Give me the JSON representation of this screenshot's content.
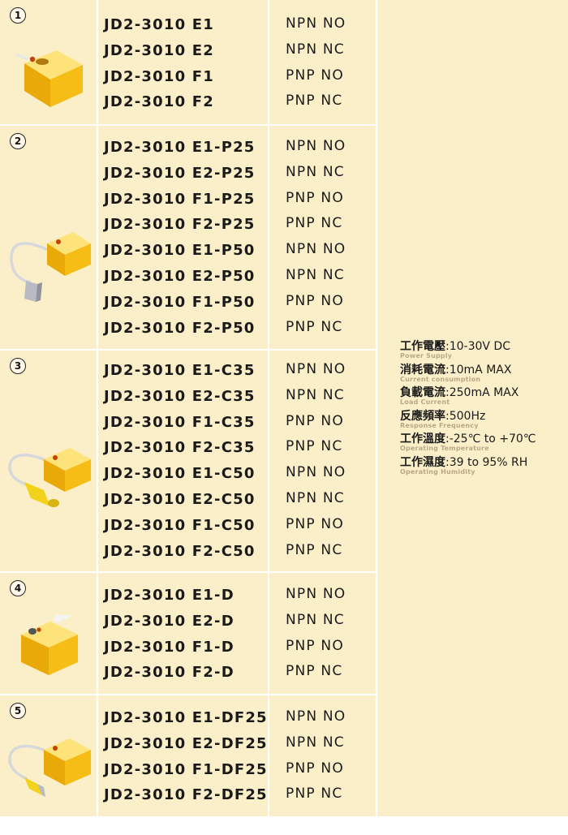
{
  "groups": [
    {
      "number": "1",
      "cable": "none",
      "rows": [
        {
          "model": "JD2-3010 E1",
          "type": "NPN NO"
        },
        {
          "model": "JD2-3010 E2",
          "type": "NPN NC"
        },
        {
          "model": "JD2-3010 F1",
          "type": "PNP NO"
        },
        {
          "model": "JD2-3010 F2",
          "type": "PNP NC"
        }
      ]
    },
    {
      "number": "2",
      "cable": "grey-connector",
      "rows": [
        {
          "model": "JD2-3010 E1-P25",
          "type": "NPN NO"
        },
        {
          "model": "JD2-3010 E2-P25",
          "type": "NPN NC"
        },
        {
          "model": "JD2-3010 F1-P25",
          "type": "PNP NO"
        },
        {
          "model": "JD2-3010 F2-P25",
          "type": "PNP NC"
        },
        {
          "model": "JD2-3010 E1-P50",
          "type": "NPN NO"
        },
        {
          "model": "JD2-3010 E2-P50",
          "type": "NPN NC"
        },
        {
          "model": "JD2-3010 F1-P50",
          "type": "PNP NO"
        },
        {
          "model": "JD2-3010 F2-P50",
          "type": "PNP NC"
        }
      ]
    },
    {
      "number": "3",
      "cable": "yellow-connector",
      "rows": [
        {
          "model": "JD2-3010 E1-C35",
          "type": "NPN NO"
        },
        {
          "model": "JD2-3010 E2-C35",
          "type": "NPN NC"
        },
        {
          "model": "JD2-3010 F1-C35",
          "type": "PNP NO"
        },
        {
          "model": "JD2-3010 F2-C35",
          "type": "PNP NC"
        },
        {
          "model": "JD2-3010 E1-C50",
          "type": "NPN NO"
        },
        {
          "model": "JD2-3010 E2-C50",
          "type": "NPN NC"
        },
        {
          "model": "JD2-3010 F1-C50",
          "type": "PNP NO"
        },
        {
          "model": "JD2-3010 F2-C50",
          "type": "PNP NC"
        }
      ]
    },
    {
      "number": "4",
      "cable": "none",
      "rows": [
        {
          "model": "JD2-3010 E1-D",
          "type": "NPN NO"
        },
        {
          "model": "JD2-3010 E2-D",
          "type": "NPN NC"
        },
        {
          "model": "JD2-3010 F1-D",
          "type": "PNP NO"
        },
        {
          "model": "JD2-3010 F2-D",
          "type": "PNP NC"
        }
      ]
    },
    {
      "number": "5",
      "cable": "yellow-small-connector",
      "rows": [
        {
          "model": "JD2-3010 E1-DF25",
          "type": "NPN NO"
        },
        {
          "model": "JD2-3010 E2-DF25",
          "type": "NPN NC"
        },
        {
          "model": "JD2-3010 F1-DF25",
          "type": "PNP NO"
        },
        {
          "model": "JD2-3010 F2-DF25",
          "type": "PNP NC"
        }
      ]
    }
  ],
  "specs": [
    {
      "label": "工作電壓",
      "value": ":10-30V DC",
      "sub": "Power Supply"
    },
    {
      "label": "消耗電流",
      "value": ":10mA MAX",
      "sub": "Current consumption"
    },
    {
      "label": "負載電流",
      "value": ":250mA MAX",
      "sub": "Load Current"
    },
    {
      "label": "反應頻率",
      "value": ":500Hz",
      "sub": "Response Frequency"
    },
    {
      "label": "工作溫度",
      "value": ":-25℃ to +70℃",
      "sub": "Operating Temperature"
    },
    {
      "label": "工作濕度",
      "value": ":39 to 95% RH",
      "sub": "Operating Humidity"
    }
  ],
  "colors": {
    "cell_background": "#fbefc9",
    "grid_lines": "#ffffff",
    "sensor_body": "#f6c21b",
    "text": "#1a1a1a",
    "spec_subtitle": "#b9a886"
  }
}
